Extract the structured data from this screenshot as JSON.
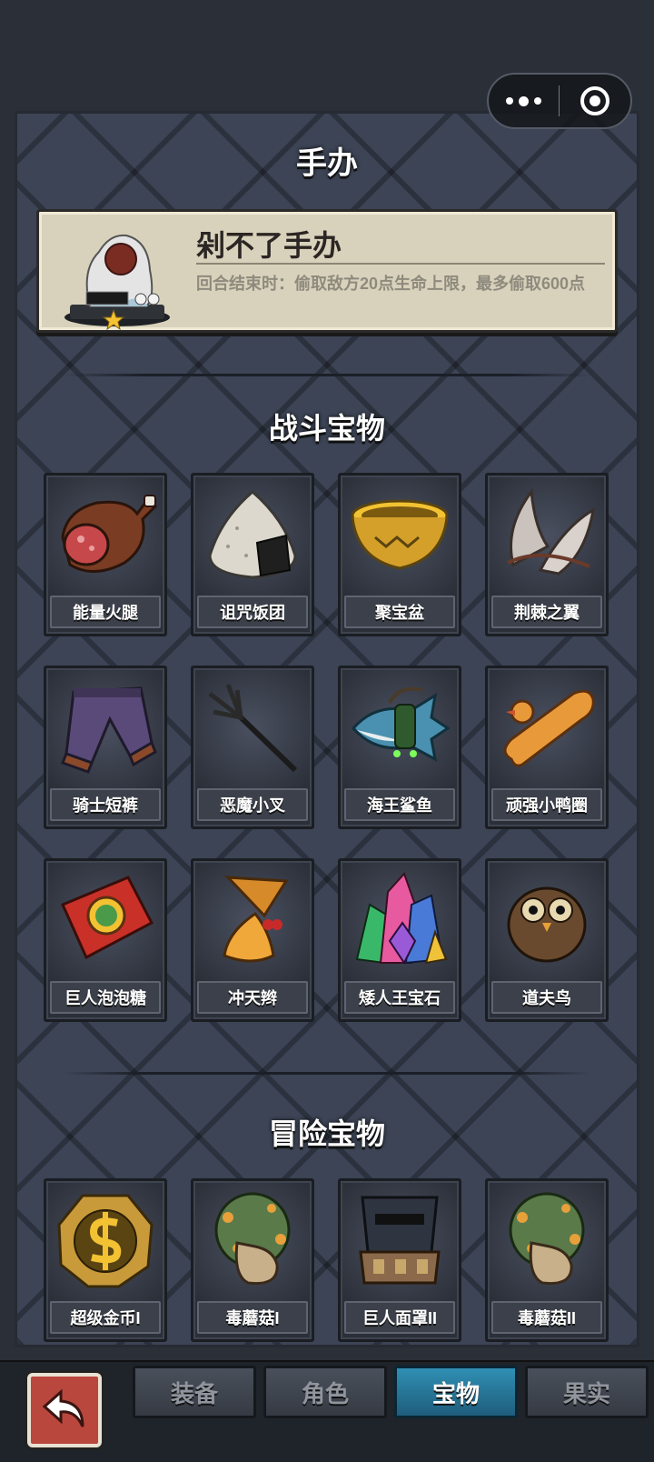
{
  "header": {
    "title": "手办"
  },
  "featured": {
    "name": "剁不了手办",
    "description": "回合结束时：偷取敌方20点生命上限，最多偷取600点"
  },
  "sections": {
    "battle": {
      "title": "战斗宝物",
      "items": [
        {
          "label": "能量火腿",
          "icon": "ham-icon"
        },
        {
          "label": "诅咒饭团",
          "icon": "riceball-icon"
        },
        {
          "label": "聚宝盆",
          "icon": "treasure-bowl-icon"
        },
        {
          "label": "荆棘之翼",
          "icon": "thorn-wing-icon"
        },
        {
          "label": "骑士短裤",
          "icon": "shorts-icon"
        },
        {
          "label": "恶魔小叉",
          "icon": "trident-icon"
        },
        {
          "label": "海王鲨鱼",
          "icon": "shark-icon"
        },
        {
          "label": "顽强小鸭圈",
          "icon": "duck-ring-icon"
        },
        {
          "label": "巨人泡泡糖",
          "icon": "gum-box-icon"
        },
        {
          "label": "冲天辫",
          "icon": "ponytail-icon"
        },
        {
          "label": "矮人王宝石",
          "icon": "gem-icon"
        },
        {
          "label": "道夫鸟",
          "icon": "owl-icon"
        }
      ]
    },
    "adventure": {
      "title": "冒险宝物",
      "items": [
        {
          "label": "超级金币I",
          "icon": "gold-coin-icon"
        },
        {
          "label": "毒蘑菇I",
          "icon": "poison-mushroom-icon"
        },
        {
          "label": "巨人面罩II",
          "icon": "giant-mask-icon"
        },
        {
          "label": "毒蘑菇II",
          "icon": "poison-mushroom-icon"
        }
      ]
    }
  },
  "tabs": [
    {
      "label": "装备",
      "active": false
    },
    {
      "label": "角色",
      "active": false
    },
    {
      "label": "宝物",
      "active": true
    },
    {
      "label": "果实",
      "active": false
    }
  ]
}
